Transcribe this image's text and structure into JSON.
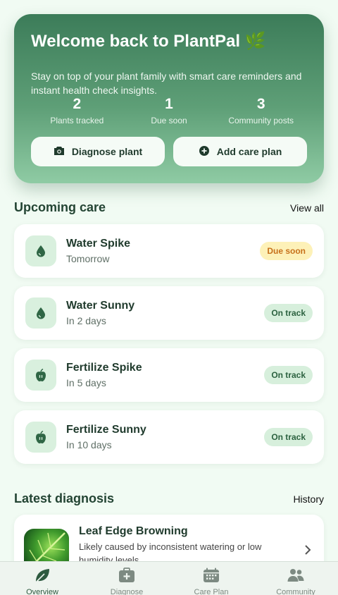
{
  "hero": {
    "title": "Welcome back to PlantPal 🌿",
    "subtitle": "Stay on top of your plant family with smart care reminders and instant health check insights.",
    "stats": [
      {
        "value": "2",
        "label": "Plants tracked"
      },
      {
        "value": "1",
        "label": "Due soon"
      },
      {
        "value": "3",
        "label": "Community posts"
      }
    ],
    "diagnose_label": "Diagnose plant",
    "add_care_label": "Add care plan"
  },
  "upcoming": {
    "title": "Upcoming care",
    "link": "View all",
    "items": [
      {
        "title": "Water Spike",
        "when": "Tomorrow",
        "status": "Due soon",
        "icon": "water-drop-icon"
      },
      {
        "title": "Water Sunny",
        "when": "In 2 days",
        "status": "On track",
        "icon": "water-drop-icon"
      },
      {
        "title": "Fertilize Spike",
        "when": "In 5 days",
        "status": "On track",
        "icon": "apple-icon"
      },
      {
        "title": "Fertilize Sunny",
        "when": "In 10 days",
        "status": "On track",
        "icon": "apple-icon"
      }
    ]
  },
  "diagnosis": {
    "title": "Latest diagnosis",
    "link": "History",
    "item": {
      "title": "Leaf Edge Browning",
      "description": "Likely caused by inconsistent watering or low humidity levels."
    }
  },
  "tabs": [
    {
      "label": "Overview",
      "icon": "leaf-icon",
      "active": true
    },
    {
      "label": "Diagnose",
      "icon": "medical-bag-icon",
      "active": false
    },
    {
      "label": "Care Plan",
      "icon": "calendar-icon",
      "active": false
    },
    {
      "label": "Community",
      "icon": "people-icon",
      "active": false
    }
  ],
  "colors": {
    "accent": "#3c7c59",
    "due_badge": "#fdf1b8",
    "ok_badge": "#d7efdc",
    "background": "#f1fbf3"
  }
}
